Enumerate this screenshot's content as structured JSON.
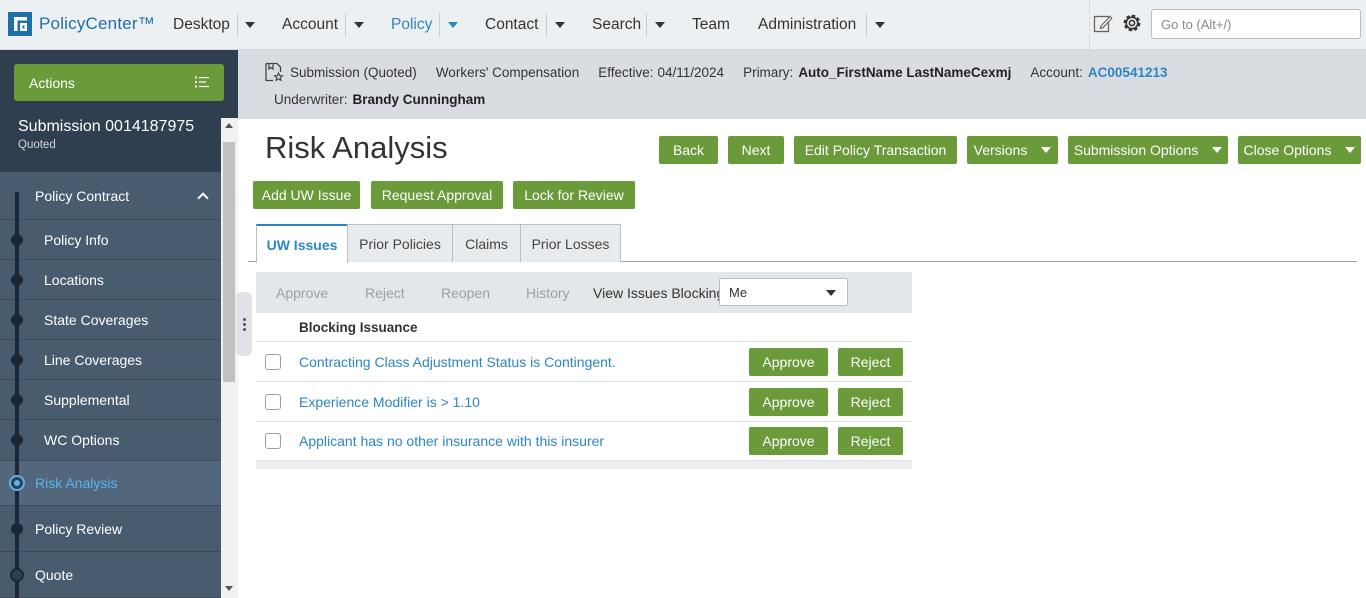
{
  "app": {
    "name": "PolicyCenter™"
  },
  "nav": {
    "desktop": "Desktop",
    "account": "Account",
    "policy": "Policy",
    "contact": "Contact",
    "search": "Search",
    "team": "Team",
    "administration": "Administration"
  },
  "goto": {
    "placeholder": "Go to (Alt+/)"
  },
  "sidebar": {
    "actions_label": "Actions",
    "submission_title": "Submission 0014187975",
    "submission_status": "Quoted",
    "items": {
      "policy_contract": "Policy Contract",
      "policy_info": "Policy Info",
      "locations": "Locations",
      "state_coverages": "State Coverages",
      "line_coverages": "Line Coverages",
      "supplemental": "Supplemental",
      "wc_options": "WC Options",
      "risk_analysis": "Risk Analysis",
      "policy_review": "Policy Review",
      "quote": "Quote"
    }
  },
  "info": {
    "submission": "Submission (Quoted)",
    "line": "Workers' Compensation",
    "effective_label": "Effective:",
    "effective_value": "04/11/2024",
    "primary_label": "Primary:",
    "primary_value": "Auto_FirstName LastNameCexmj",
    "account_label": "Account:",
    "account_value": "AC00541213",
    "underwriter_label": "Underwriter:",
    "underwriter_value": "Brandy Cunningham"
  },
  "page": {
    "title": "Risk Analysis",
    "buttons": {
      "back": "Back",
      "next": "Next",
      "edit_policy_transaction": "Edit Policy Transaction",
      "versions": "Versions",
      "submission_options": "Submission Options",
      "close_options": "Close Options",
      "add_uw_issue": "Add UW Issue",
      "request_approval": "Request Approval",
      "lock_for_review": "Lock for Review"
    },
    "tabs": {
      "uw_issues": "UW Issues",
      "prior_policies": "Prior Policies",
      "claims": "Claims",
      "prior_losses": "Prior Losses"
    }
  },
  "issues": {
    "toolbar": {
      "approve": "Approve",
      "reject": "Reject",
      "reopen": "Reopen",
      "history": "History",
      "view_blocking_label": "View Issues Blocking",
      "view_blocking_value": "Me"
    },
    "column_header": "Blocking Issuance",
    "approve_label": "Approve",
    "reject_label": "Reject",
    "rows": [
      "Contracting Class Adjustment Status is Contingent.",
      "Experience Modifier is > 1.10",
      "Applicant has no other insurance with this insurer"
    ]
  }
}
